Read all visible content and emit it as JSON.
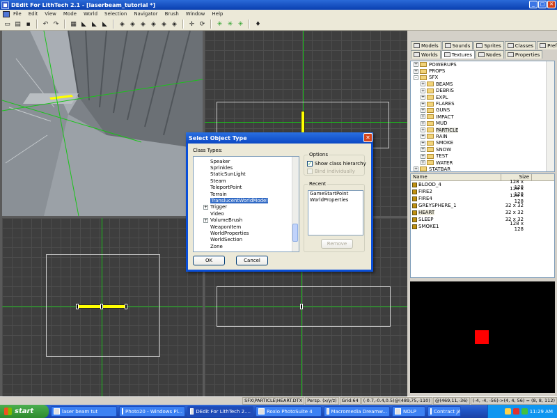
{
  "window": {
    "title": "DEdit For LithTech 2.1 - [laserbeam_tutorial *]",
    "min": "_",
    "max": "□",
    "close": "✕"
  },
  "menu": [
    "File",
    "Edit",
    "View",
    "Mode",
    "World",
    "Selection",
    "Navigator",
    "Brush",
    "Window",
    "Help"
  ],
  "toolbar_icons": [
    "new-icon",
    "open-icon",
    "save-icon",
    "sep",
    "undo-icon",
    "redo-icon",
    "sep",
    "grid-icon",
    "tool-icon",
    "tool-icon",
    "tool-icon",
    "sep",
    "brush-icon",
    "brush-icon",
    "brush-icon",
    "brush-icon",
    "brush-icon",
    "brush-icon",
    "sep",
    "move-icon",
    "rotate-icon",
    "sep",
    "green-star-icon",
    "green-star-icon",
    "green-star-icon",
    "sep",
    "light-icon"
  ],
  "panel": {
    "tabs_row1": [
      "Models",
      "Sounds",
      "Sprites",
      "Classes",
      "Prefabs"
    ],
    "tabs_row2": [
      "Worlds",
      "Textures",
      "Nodes",
      "Properties"
    ],
    "active_tab": "Textures",
    "tree": [
      {
        "label": "POWERUPS",
        "level": 0,
        "exp": "+"
      },
      {
        "label": "PROPS",
        "level": 0,
        "exp": "+"
      },
      {
        "label": "SFX",
        "level": 0,
        "exp": "-"
      },
      {
        "label": "BEAMS",
        "level": 1,
        "exp": "+"
      },
      {
        "label": "DEBRIS",
        "level": 1,
        "exp": "+"
      },
      {
        "label": "EXPL",
        "level": 1,
        "exp": "+"
      },
      {
        "label": "FLARES",
        "level": 1,
        "exp": "+"
      },
      {
        "label": "GUNS",
        "level": 1,
        "exp": "+"
      },
      {
        "label": "IMPACT",
        "level": 1,
        "exp": "+"
      },
      {
        "label": "MUD",
        "level": 1,
        "exp": "+"
      },
      {
        "label": "PARTICLE",
        "level": 1,
        "exp": "+",
        "selected": true
      },
      {
        "label": "RAIN",
        "level": 1,
        "exp": "+"
      },
      {
        "label": "SMOKE",
        "level": 1,
        "exp": "+"
      },
      {
        "label": "SNOW",
        "level": 1,
        "exp": "+"
      },
      {
        "label": "TEST",
        "level": 1,
        "exp": "+"
      },
      {
        "label": "WATER",
        "level": 1,
        "exp": "+"
      },
      {
        "label": "STATBAR",
        "level": 0,
        "exp": "+"
      }
    ],
    "list_headers": {
      "name": "Name",
      "size": "Size"
    },
    "textures": [
      {
        "name": "BLOOD_4",
        "size": "128 x 128"
      },
      {
        "name": "FIRE2",
        "size": "128 x 128"
      },
      {
        "name": "FIRE4",
        "size": "128 x 128"
      },
      {
        "name": "GREYSPHERE_1",
        "size": "32 x 32"
      },
      {
        "name": "HEART",
        "size": "32 x 32",
        "selected": true
      },
      {
        "name": "SLEEP",
        "size": "32 x 32"
      },
      {
        "name": "SMOKE1",
        "size": "128 x 128"
      }
    ],
    "preview_color": "#ff0000"
  },
  "status": {
    "path": "SFX\\PARTICLE\\HEART.DTX",
    "view": "Persp. (x/y/z)",
    "grid": "Grid:64",
    "pos1": "(-0.7,-0.4,0.5)@(489,75,-110)",
    "pos2": "@(469,11,-36)",
    "dims": "(-4, -4, -56)->(4, 4, 56) = (8, 8, 112)"
  },
  "dialog": {
    "title": "Select Object Type",
    "close": "✕",
    "class_types_label": "Class Types:",
    "classes": [
      {
        "label": "Speaker",
        "exp": ""
      },
      {
        "label": "Sprinkles",
        "exp": ""
      },
      {
        "label": "StaticSunLight",
        "exp": ""
      },
      {
        "label": "Steam",
        "exp": ""
      },
      {
        "label": "TeleportPoint",
        "exp": ""
      },
      {
        "label": "Terrain",
        "exp": ""
      },
      {
        "label": "TranslucentWorldModel",
        "exp": "",
        "selected": true
      },
      {
        "label": "Trigger",
        "exp": "+"
      },
      {
        "label": "Video",
        "exp": ""
      },
      {
        "label": "VolumeBrush",
        "exp": "+"
      },
      {
        "label": "WeaponItem",
        "exp": ""
      },
      {
        "label": "WorldProperties",
        "exp": ""
      },
      {
        "label": "WorldSection",
        "exp": ""
      },
      {
        "label": "Zone",
        "exp": ""
      }
    ],
    "options_label": "Options",
    "show_hierarchy": "Show class hierarchy",
    "show_hierarchy_checked": "✓",
    "bind_individually": "Bind individually",
    "recent_label": "Recent",
    "recent": [
      "GameStartPoint",
      "WorldProperties"
    ],
    "remove": "Remove",
    "ok": "OK",
    "cancel": "Cancel"
  },
  "taskbar": {
    "start": "start",
    "tasks": [
      {
        "label": "laser beam tut",
        "active": false
      },
      {
        "label": "Photo20 - Windows Pi...",
        "active": false
      },
      {
        "label": "DEdit For LithTech 2....",
        "active": true
      },
      {
        "label": "Roxio PhotoSuite 4",
        "active": false
      },
      {
        "label": "Macromedia Dreamw...",
        "active": false
      },
      {
        "label": "NOLP",
        "active": false
      },
      {
        "label": "Contract JACK",
        "active": false
      }
    ],
    "clock": "11:29 AM"
  }
}
